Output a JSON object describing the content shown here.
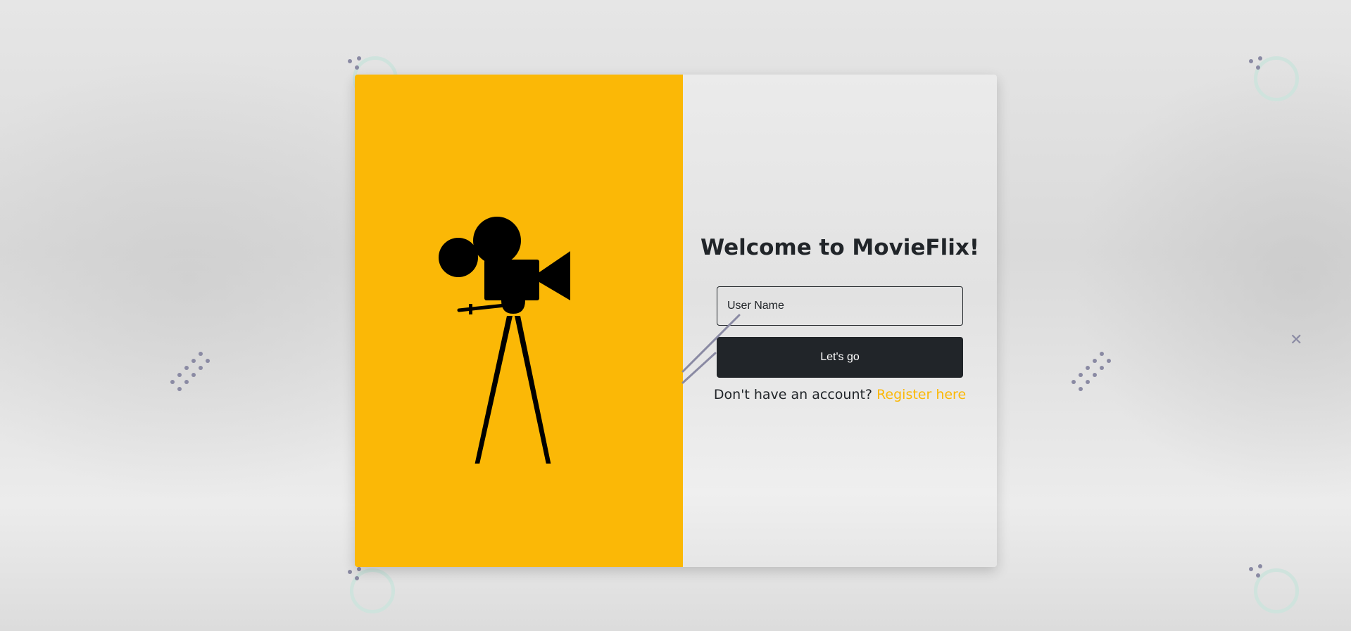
{
  "app": {
    "name": "MovieFlix"
  },
  "login": {
    "title": "Welcome to MovieFlix!",
    "username_placeholder": "User Name",
    "username_value": "",
    "submit_label": "Let's go",
    "register_prompt": "Don't have an account?",
    "register_link": "Register here"
  },
  "illustration": {
    "icon": "movie-camera-on-tripod-icon"
  },
  "colors": {
    "accent": "#fbb806",
    "button_bg": "#212529",
    "button_text": "#ffffff",
    "decoration_ring": "#cfe3dd",
    "decoration_dots": "#8a8aa3"
  }
}
